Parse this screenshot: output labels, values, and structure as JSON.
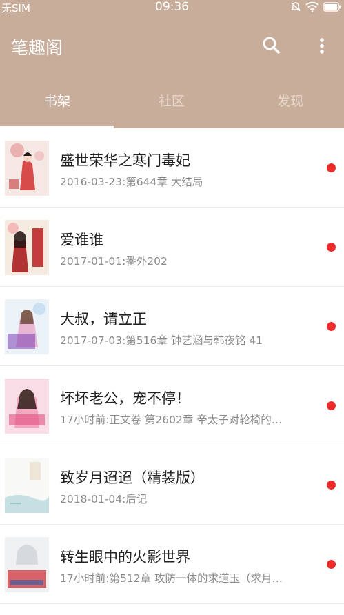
{
  "status_bar": {
    "carrier": "无SIM",
    "time": "09:36",
    "icons": [
      "mute-icon",
      "wifi-icon",
      "battery-icon"
    ]
  },
  "app_bar": {
    "title": "笔趣阁",
    "icons": [
      "search-icon",
      "more-vert-icon"
    ]
  },
  "tabs": [
    {
      "label": "书架",
      "active": true
    },
    {
      "label": "社区",
      "active": false
    },
    {
      "label": "发现",
      "active": false
    }
  ],
  "colors": {
    "header_bg": "#c9ad9b",
    "unread_dot": "#ee2b2b"
  },
  "books": [
    {
      "title": "盛世荣华之寒门毒妃",
      "subtitle": "2016-03-23:第644章 大结局",
      "unread": true
    },
    {
      "title": "爱谁谁",
      "subtitle": "2017-01-01:番外202",
      "unread": true
    },
    {
      "title": "大叔，请立正",
      "subtitle": "2017-07-03:第516章 钟艺涵与韩夜铭 41",
      "unread": true
    },
    {
      "title": "坏坏老公，宠不停！",
      "subtitle": "17小时前:正文卷 第2602章 帝太子对轮椅的…",
      "unread": true
    },
    {
      "title": "致岁月迢迢（精装版）",
      "subtitle": "2018-01-04:后记",
      "unread": true
    },
    {
      "title": "转生眼中的火影世界",
      "subtitle": "17小时前:第512章 攻防一体的求道玉（求月…",
      "unread": true
    }
  ]
}
